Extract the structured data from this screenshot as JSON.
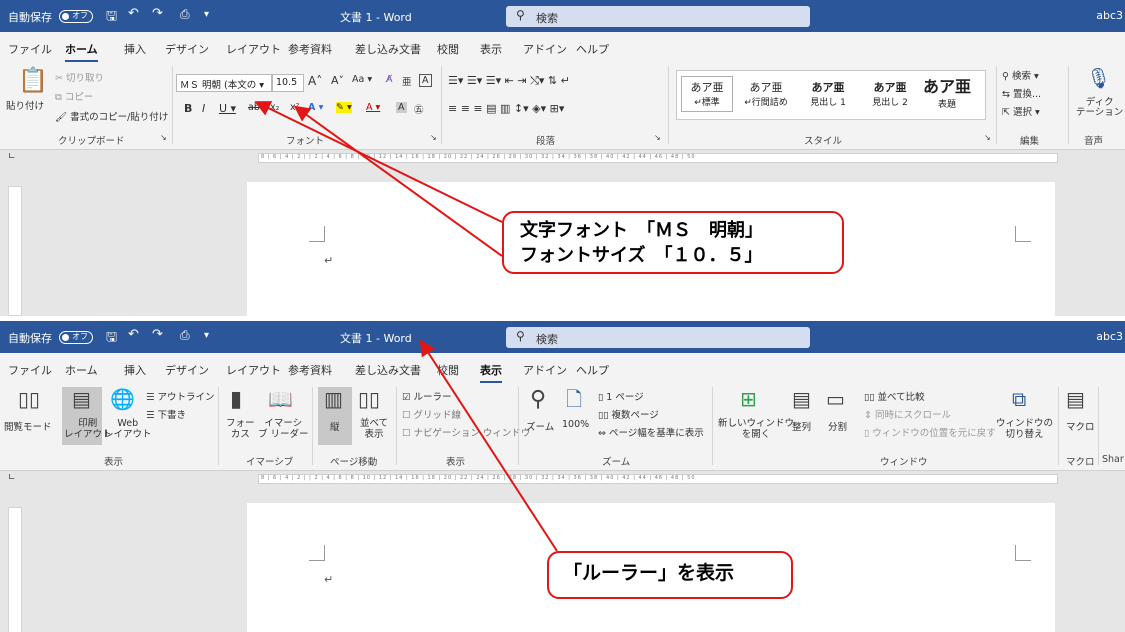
{
  "title_bar": {
    "autosave_label": "自動保存",
    "autosave_state": "オフ",
    "doc_title": "文書 1  -  Word",
    "search_placeholder": "検索",
    "account": "abc3"
  },
  "tabs": [
    "ファイル",
    "ホーム",
    "挿入",
    "デザイン",
    "レイアウト",
    "参考資料",
    "差し込み文書",
    "校閲",
    "表示",
    "アドイン",
    "ヘルプ"
  ],
  "screenshot1": {
    "active_tab": "ホーム",
    "clipboard": {
      "paste": "貼り付け",
      "cut": "切り取り",
      "copy": "コピー",
      "format_painter": "書式のコピー/貼り付け",
      "group_label": "クリップボード"
    },
    "font": {
      "font_name": "ＭＳ 明朝 (本文の",
      "font_size": "10.5",
      "group_label": "フォント"
    },
    "paragraph": {
      "group_label": "段落"
    },
    "styles": {
      "items": [
        {
          "preview": "あア亜",
          "name": "標準"
        },
        {
          "preview": "あア亜",
          "name": "行間詰め"
        },
        {
          "preview": "あア亜",
          "name": "見出し 1"
        },
        {
          "preview": "あア亜",
          "name": "見出し 2"
        },
        {
          "preview": "あア亜",
          "name": "表題"
        }
      ],
      "group_label": "スタイル"
    },
    "editing": {
      "find": "検索",
      "replace": "置換...",
      "select": "選択",
      "group_label": "編集"
    },
    "voice": {
      "dictate": "ディク\nテーション",
      "group_label": "音声"
    },
    "callout_line1": "文字フォント　「ＭＳ　明朝」",
    "callout_line2": "フォントサイズ　「１０．５」"
  },
  "screenshot2": {
    "active_tab": "表示",
    "views": {
      "read_mode": "閲覧モード",
      "print_layout": "印刷\nレイアウト",
      "web_layout": "Web\nレイアウト",
      "outline": "アウトライン",
      "draft": "下書き",
      "group_label": "表示"
    },
    "immersive": {
      "focus": "フォー\nカス",
      "immersive_reader": "イマーシ\nブ リーダー",
      "group_label": "イマーシブ"
    },
    "page_movement": {
      "vertical": "縦",
      "side_by_side": "並べて\n表示",
      "group_label": "ページ移動"
    },
    "show": {
      "ruler": "ルーラー",
      "ruler_checked": true,
      "gridlines": "グリッド線",
      "gridlines_checked": false,
      "nav_pane": "ナビゲーション ウィンドウ",
      "nav_pane_checked": false,
      "group_label": "表示"
    },
    "zoom": {
      "zoom": "ズーム",
      "hundred": "100%",
      "one_page": "1 ページ",
      "multiple_pages": "複数ページ",
      "page_width": "ページ幅を基準に表示",
      "group_label": "ズーム"
    },
    "window": {
      "new_window": "新しいウィンドウ\nを開く",
      "arrange": "整列",
      "split": "分割",
      "compare": "並べて比較",
      "sync_scroll": "同時にスクロール",
      "reset_position": "ウィンドウの位置を元に戻す",
      "switch_windows": "ウィンドウの\n切り替え",
      "group_label": "ウィンドウ"
    },
    "macros": {
      "macro": "マクロ",
      "group_label": "マクロ"
    },
    "share_label": "Shar",
    "callout": "「ルーラー」を表示"
  },
  "ruler_numbers": "8 | 6 | 4 | 2 |   | 2 | 4 | 6 | 8 | 10 | 12 | 14 | 16 | 18 | 20 | 22 | 24 | 26 | 28 | 30 | 32 | 34 | 36 | 38 | 40 | 42 | 44 | 46 | 48 | 50",
  "colors": {
    "title_bar": "#2b579a",
    "callout_border": "#e31515",
    "ribbon_bg": "#f3f3f3",
    "workspace": "#e6e6e6"
  }
}
